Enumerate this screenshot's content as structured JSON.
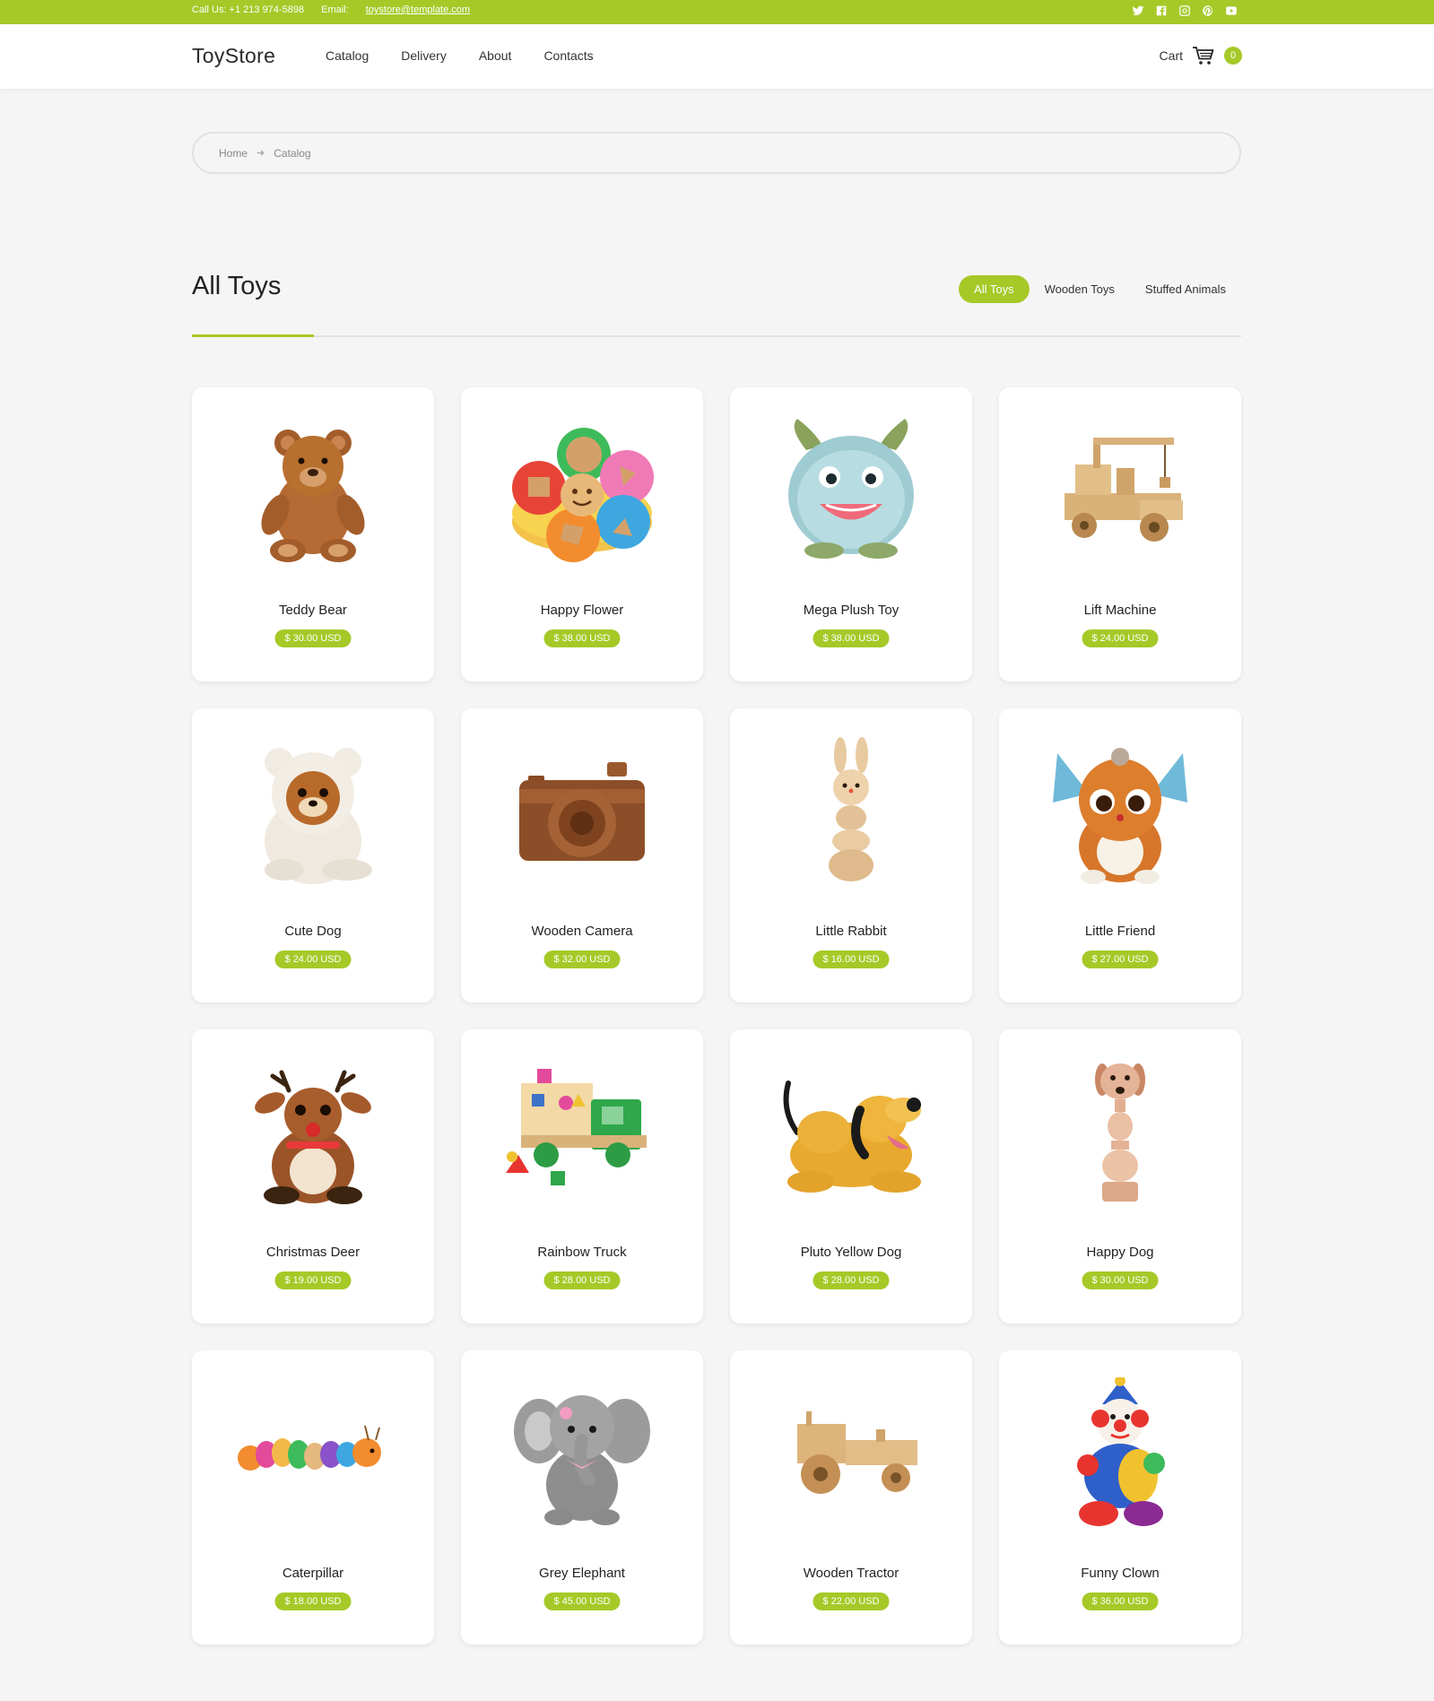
{
  "topbar": {
    "phone": "Call Us: +1 213 974-5898",
    "email_label": "Email:",
    "email": "toystore@template.com",
    "social": [
      "twitter-icon",
      "facebook-icon",
      "instagram-icon",
      "pinterest-icon",
      "youtube-icon"
    ]
  },
  "header": {
    "logo": "ToyStore",
    "nav": [
      "Catalog",
      "Delivery",
      "About",
      "Contacts"
    ],
    "cart_label": "Cart",
    "cart_count": "0"
  },
  "breadcrumb": [
    "Home",
    "Catalog"
  ],
  "section": {
    "title": "All Toys",
    "tabs": [
      "All Toys",
      "Wooden Toys",
      "Stuffed Animals"
    ],
    "active_tab": "All Toys"
  },
  "products": [
    {
      "name": "Teddy Bear",
      "price": "$ 30.00 USD",
      "icon": "teddy-bear-icon"
    },
    {
      "name": "Happy Flower",
      "price": "$ 38.00 USD",
      "icon": "flower-sorter-icon"
    },
    {
      "name": "Mega Plush Toy",
      "price": "$ 38.00 USD",
      "icon": "plush-monster-icon"
    },
    {
      "name": "Lift Machine",
      "price": "$ 24.00 USD",
      "icon": "wooden-crane-icon"
    },
    {
      "name": "Cute Dog",
      "price": "$ 24.00 USD",
      "icon": "plush-dog-icon"
    },
    {
      "name": "Wooden Camera",
      "price": "$ 32.00 USD",
      "icon": "wooden-camera-icon"
    },
    {
      "name": "Little Rabbit",
      "price": "$ 16.00 USD",
      "icon": "wooden-rabbit-icon"
    },
    {
      "name": "Little Friend",
      "price": "$ 27.00 USD",
      "icon": "plush-fox-icon"
    },
    {
      "name": "Christmas Deer",
      "price": "$ 19.00 USD",
      "icon": "plush-deer-icon"
    },
    {
      "name": "Rainbow Truck",
      "price": "$ 28.00 USD",
      "icon": "shape-truck-icon"
    },
    {
      "name": "Pluto Yellow Dog",
      "price": "$ 28.00 USD",
      "icon": "yellow-dog-icon"
    },
    {
      "name": "Happy Dog",
      "price": "$ 30.00 USD",
      "icon": "wooden-dog-icon"
    },
    {
      "name": "Caterpillar",
      "price": "$ 18.00 USD",
      "icon": "caterpillar-icon"
    },
    {
      "name": "Grey Elephant",
      "price": "$ 45.00 USD",
      "icon": "plush-elephant-icon"
    },
    {
      "name": "Wooden Tractor",
      "price": "$ 22.00 USD",
      "icon": "wooden-tractor-icon"
    },
    {
      "name": "Funny Clown",
      "price": "$ 36.00 USD",
      "icon": "clown-icon"
    }
  ],
  "colors": {
    "accent": "#a6c928",
    "background": "#f5f5f6"
  }
}
